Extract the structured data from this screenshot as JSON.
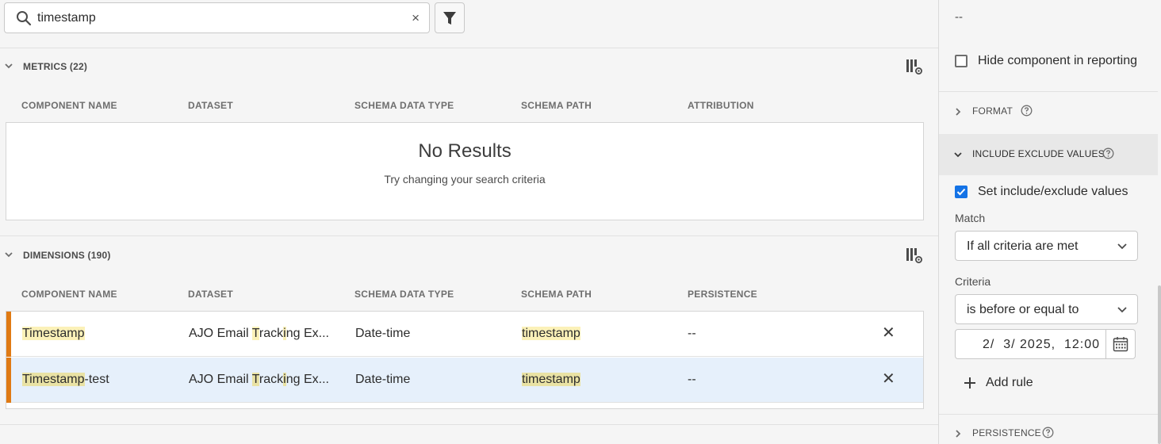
{
  "search": {
    "value": "timestamp",
    "clear": "×"
  },
  "metrics": {
    "title": "METRICS (22)",
    "columns": [
      "COMPONENT NAME",
      "DATASET",
      "SCHEMA DATA TYPE",
      "SCHEMA PATH",
      "ATTRIBUTION"
    ],
    "empty_title": "No Results",
    "empty_subtitle": "Try changing your search criteria"
  },
  "dimensions": {
    "title": "DIMENSIONS (190)",
    "columns": [
      "COMPONENT NAME",
      "DATASET",
      "SCHEMA DATA TYPE",
      "SCHEMA PATH",
      "PERSISTENCE"
    ],
    "rows": [
      {
        "name_hl": "Timestamp",
        "name_rest": "",
        "dataset": {
          "a": "AJO Email ",
          "b": "T",
          "c": "rack",
          "d": "i",
          "e": "ng Ex..."
        },
        "type": "Date-time",
        "path": "timestamp",
        "persistence": "--",
        "remove": "✕",
        "selected": false
      },
      {
        "name_hl": "Timestamp",
        "name_rest": "-test",
        "dataset": {
          "a": "AJO Email ",
          "b": "T",
          "c": "rack",
          "d": "i",
          "e": "ng Ex..."
        },
        "type": "Date-time",
        "path": "timestamp",
        "persistence": "--",
        "remove": "✕",
        "selected": true
      }
    ]
  },
  "panel": {
    "dash": "--",
    "hide_label": "Hide component in reporting",
    "format_title": "FORMAT",
    "include_title": "INCLUDE EXCLUDE VALUES",
    "set_label": "Set include/exclude values",
    "match_label": "Match",
    "match_value": "If all criteria are met",
    "criteria_label": "Criteria",
    "criteria_value": "is before or equal to",
    "date_value": "2/  3/ 2025,  12:00",
    "add_rule": "Add rule",
    "persistence_title": "PERSISTENCE"
  }
}
